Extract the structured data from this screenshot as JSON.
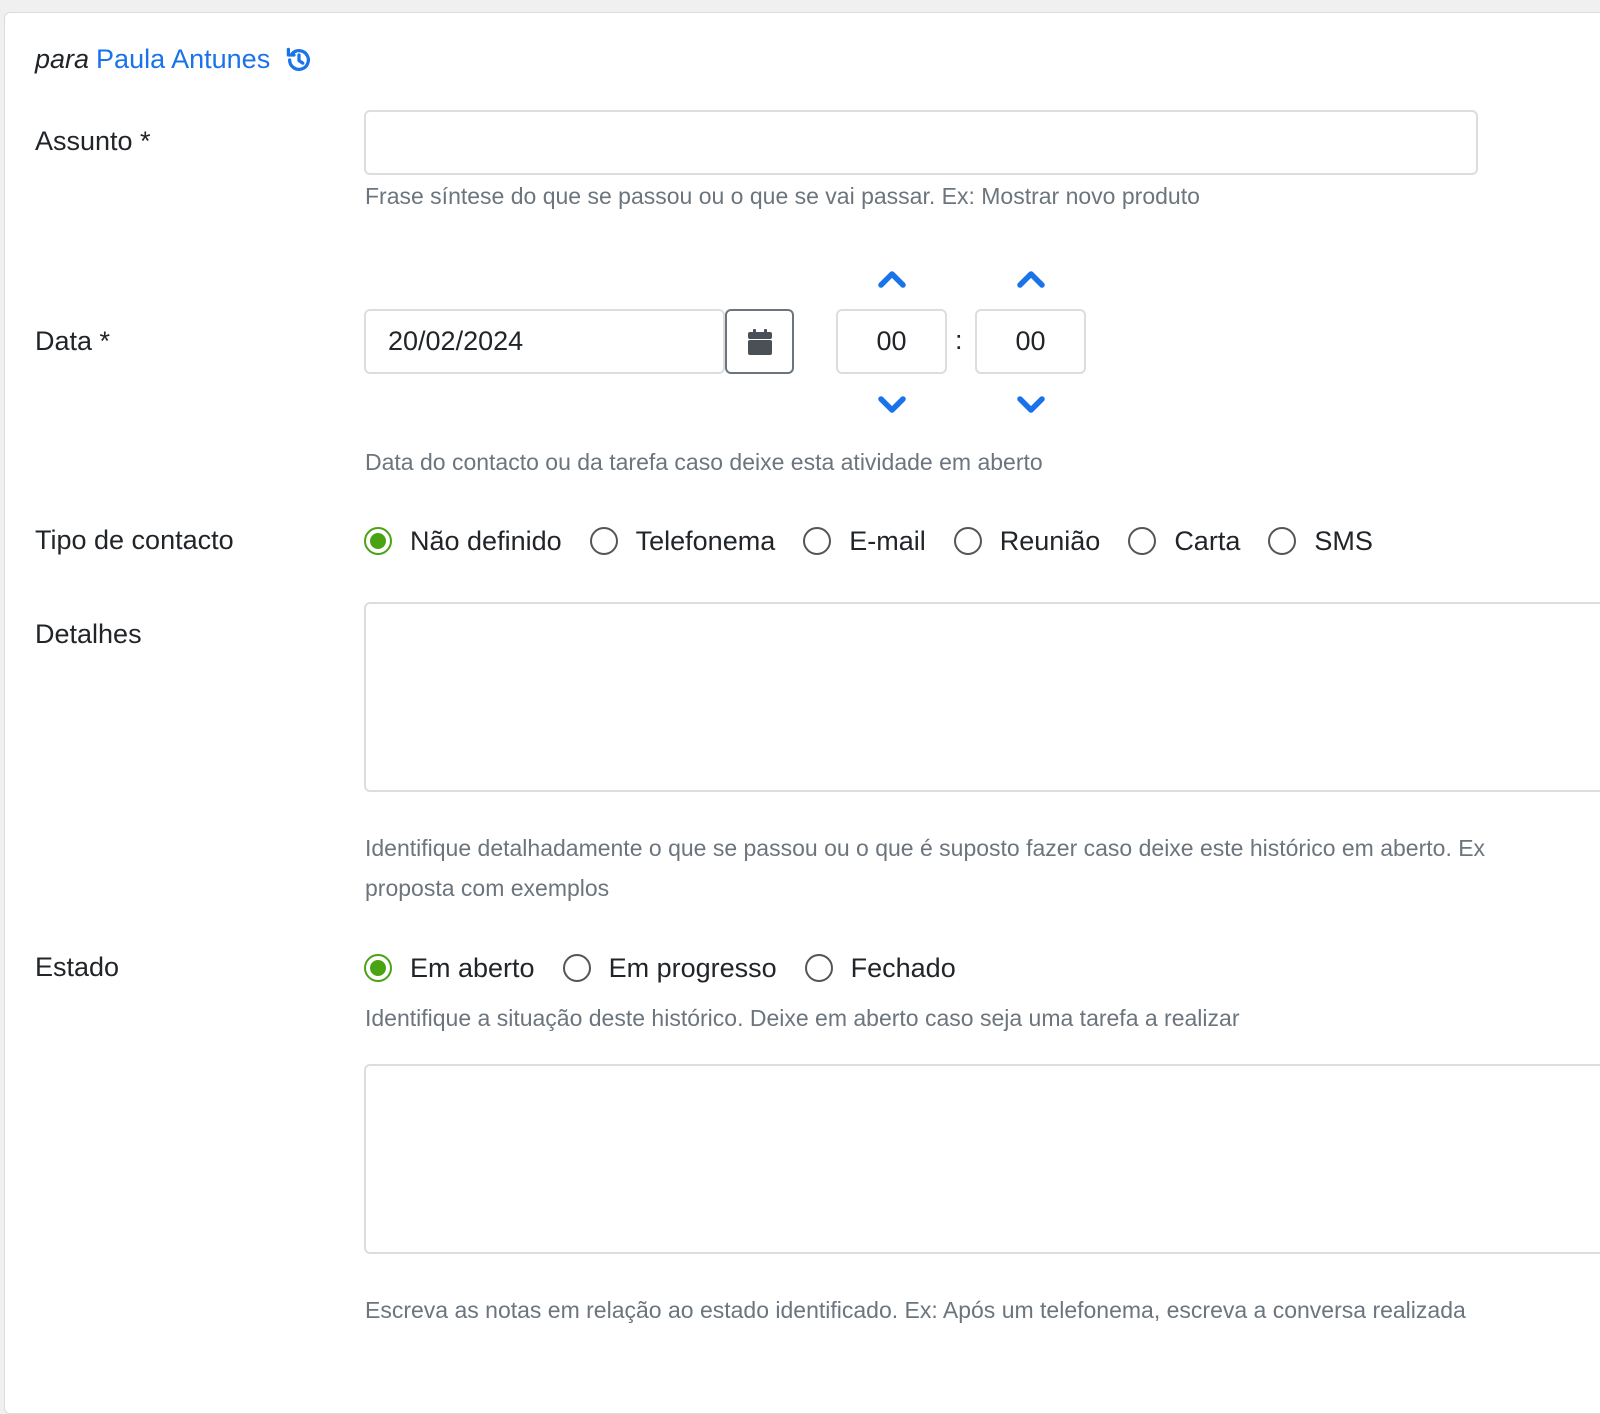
{
  "header": {
    "prefix": "para",
    "contact_name": "Paula Antunes",
    "history_icon": "history-icon"
  },
  "assunto": {
    "label": "Assunto *",
    "value": "",
    "help": "Frase síntese do que se passou ou o que se vai passar. Ex: Mostrar novo produto"
  },
  "data": {
    "label": "Data *",
    "date_value": "20/02/2024",
    "hour": "00",
    "separator": ":",
    "minute": "00",
    "calendar_icon": "calendar-icon",
    "help": "Data do contacto ou da tarefa caso deixe esta atividade em aberto"
  },
  "tipo": {
    "label": "Tipo de contacto",
    "options": [
      "Não definido",
      "Telefonema",
      "E-mail",
      "Reunião",
      "Carta",
      "SMS"
    ],
    "selected": "Não definido"
  },
  "detalhes": {
    "label": "Detalhes",
    "value": "",
    "help_line1": "Identifique detalhadamente o que se passou ou o que é suposto fazer caso deixe este histórico em aberto. Ex",
    "help_line2": "proposta com exemplos"
  },
  "estado": {
    "label": "Estado",
    "options": [
      "Em aberto",
      "Em progresso",
      "Fechado"
    ],
    "selected": "Em aberto",
    "help": "Identifique a situação deste histórico. Deixe em aberto caso seja uma tarefa a realizar",
    "notes_value": "",
    "notes_help": "Escreva as notas em relação ao estado identificado. Ex: Após um telefonema, escreva a conversa realizada"
  },
  "colors": {
    "accent_blue": "#1a73e8",
    "radio_checked": "#4aa313",
    "help_text": "#6c757d"
  }
}
